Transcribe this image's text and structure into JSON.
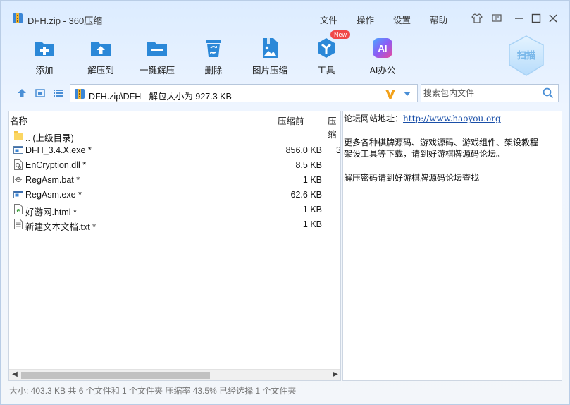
{
  "window": {
    "title": "DFH.zip - 360压缩",
    "menus": [
      "文件",
      "操作",
      "设置",
      "帮助"
    ]
  },
  "toolbar": {
    "items": [
      {
        "label": "添加",
        "icon": "add-folder-icon"
      },
      {
        "label": "解压到",
        "icon": "extract-to-icon"
      },
      {
        "label": "一键解压",
        "icon": "one-click-extract-icon"
      },
      {
        "label": "删除",
        "icon": "trash-icon"
      },
      {
        "label": "图片压缩",
        "icon": "image-compress-icon"
      },
      {
        "label": "工具",
        "icon": "tools-icon",
        "badge": "New"
      },
      {
        "label": "AI办公",
        "icon": "ai-office-icon",
        "icon_text": "AI"
      }
    ],
    "scan_label": "扫描"
  },
  "pathbar": {
    "path": "DFH.zip\\DFH - 解包大小为 927.3 KB",
    "search_placeholder": "搜索包内文件"
  },
  "filelist": {
    "columns": [
      "名称",
      "压缩前",
      "压缩"
    ],
    "rows": [
      {
        "name": ".. (上级目录)",
        "size": "",
        "icon": "folder-icon"
      },
      {
        "name": "DFH_3.4.X.exe *",
        "size": "856.0 KB",
        "trunc": "3",
        "icon": "exe-file-icon"
      },
      {
        "name": "EnCryption.dll *",
        "size": "8.5 KB",
        "icon": "dll-file-icon"
      },
      {
        "name": "RegAsm.bat *",
        "size": "1 KB",
        "icon": "bat-file-icon"
      },
      {
        "name": "RegAsm.exe *",
        "size": "62.6 KB",
        "icon": "exe-file-icon"
      },
      {
        "name": "好游网.html *",
        "size": "1 KB",
        "icon": "html-file-icon"
      },
      {
        "name": "新建文本文档.txt *",
        "size": "1 KB",
        "icon": "txt-file-icon"
      }
    ]
  },
  "comment": {
    "line1_prefix": "论坛网站地址：",
    "line1_link": "http://www.haoyou.org",
    "line2": "更多各种棋牌源码、游戏源码、游戏组件、架设教程",
    "line3": "架设工具等下载，请到好游棋牌源码论坛。",
    "line4": "解压密码请到好游棋牌源码论坛查找"
  },
  "status": {
    "text": "大小: 403.3 KB 共 6 个文件和 1 个文件夹 压缩率 43.5% 已经选择 1 个文件夹"
  },
  "colors": {
    "accent": "#2b88d8",
    "badge": "#f04848",
    "link": "#1a4fa8"
  }
}
